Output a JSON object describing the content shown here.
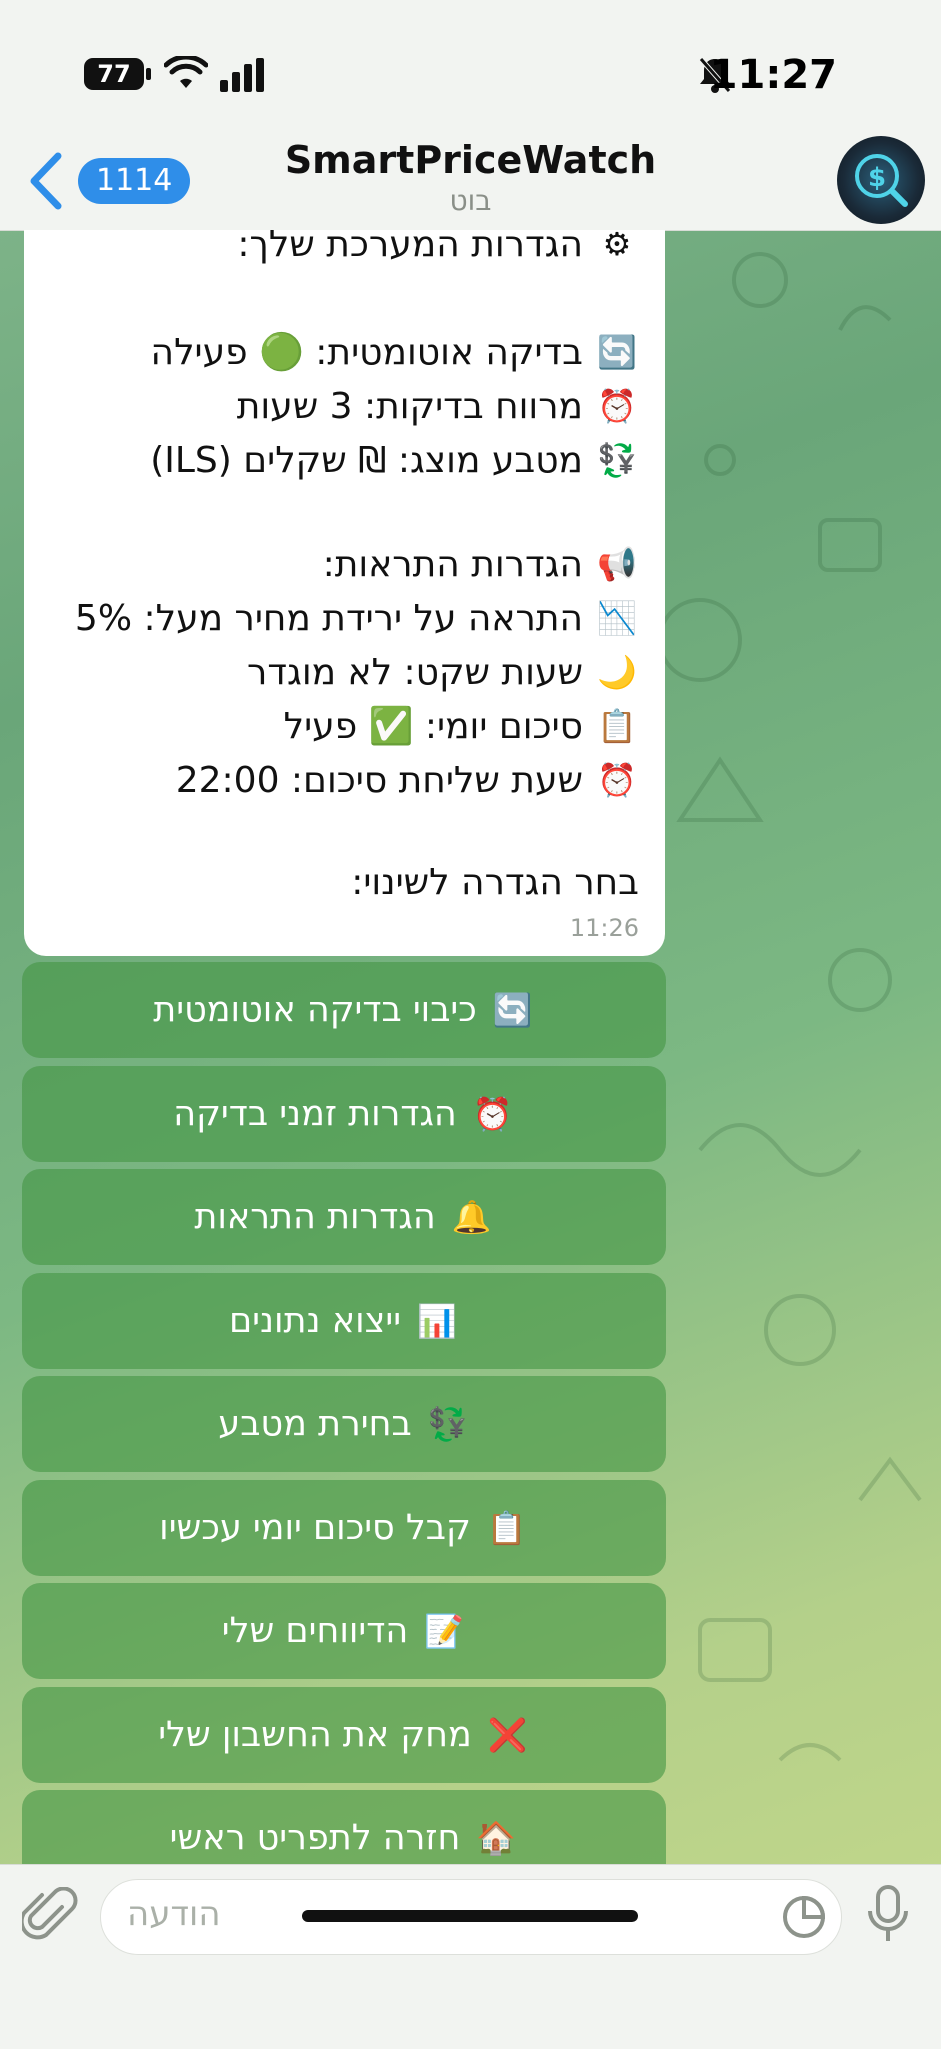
{
  "status": {
    "time": "11:27",
    "battery": "77"
  },
  "header": {
    "back_count": "1114",
    "title": "SmartPriceWatch",
    "subtitle": "בוט"
  },
  "message": {
    "lines": [
      {
        "icon": "gear-icon",
        "glyph": "⚙",
        "text": "הגדרות המערכת שלך:"
      },
      {
        "icon": "refresh-icon",
        "glyph": "🔄",
        "text": "בדיקה אוטומטית: 🟢 פעילה"
      },
      {
        "icon": "alarm-clock-icon",
        "glyph": "⏰",
        "text": "מרווח בדיקות: 3 שעות"
      },
      {
        "icon": "currency-exchange-icon",
        "glyph": "💱",
        "text": "מטבע מוצג: ₪ שקלים (ILS)"
      },
      {
        "icon": "megaphone-icon",
        "glyph": "📢",
        "text": "הגדרות התראות:"
      },
      {
        "icon": "chart-decreasing-icon",
        "glyph": "📉",
        "text": "התראה על ירידת מחיר מעל: 5%"
      },
      {
        "icon": "crescent-moon-icon",
        "glyph": "🌙",
        "text": "שעות שקט: לא מוגדר"
      },
      {
        "icon": "clipboard-icon",
        "glyph": "📋",
        "text": "סיכום יומי: ✅ פעיל"
      },
      {
        "icon": "alarm-clock-icon",
        "glyph": "⏰",
        "text": "שעת שליחת סיכום: 22:00"
      },
      {
        "icon": "",
        "glyph": "",
        "text": "בחר הגדרה לשינוי:"
      }
    ],
    "time": "11:26"
  },
  "buttons": [
    {
      "icon": "refresh-icon",
      "glyph": "🔄",
      "label": "כיבוי בדיקה אוטומטית"
    },
    {
      "icon": "alarm-clock-icon",
      "glyph": "⏰",
      "label": "הגדרות זמני בדיקה"
    },
    {
      "icon": "bell-icon",
      "glyph": "🔔",
      "label": "הגדרות התראות"
    },
    {
      "icon": "bar-chart-icon",
      "glyph": "📊",
      "label": "ייצוא נתונים"
    },
    {
      "icon": "currency-exchange-icon",
      "glyph": "💱",
      "label": "בחירת מטבע"
    },
    {
      "icon": "clipboard-icon",
      "glyph": "📋",
      "label": "קבל סיכום יומי עכשיו"
    },
    {
      "icon": "memo-icon",
      "glyph": "📝",
      "label": "הדיווחים שלי"
    },
    {
      "icon": "cross-mark-icon",
      "glyph": "❌",
      "label": "מחק את החשבון שלי"
    },
    {
      "icon": "house-icon",
      "glyph": "🏠",
      "label": "חזרה לתפריט ראשי"
    }
  ],
  "composer": {
    "placeholder": "הודעה"
  }
}
